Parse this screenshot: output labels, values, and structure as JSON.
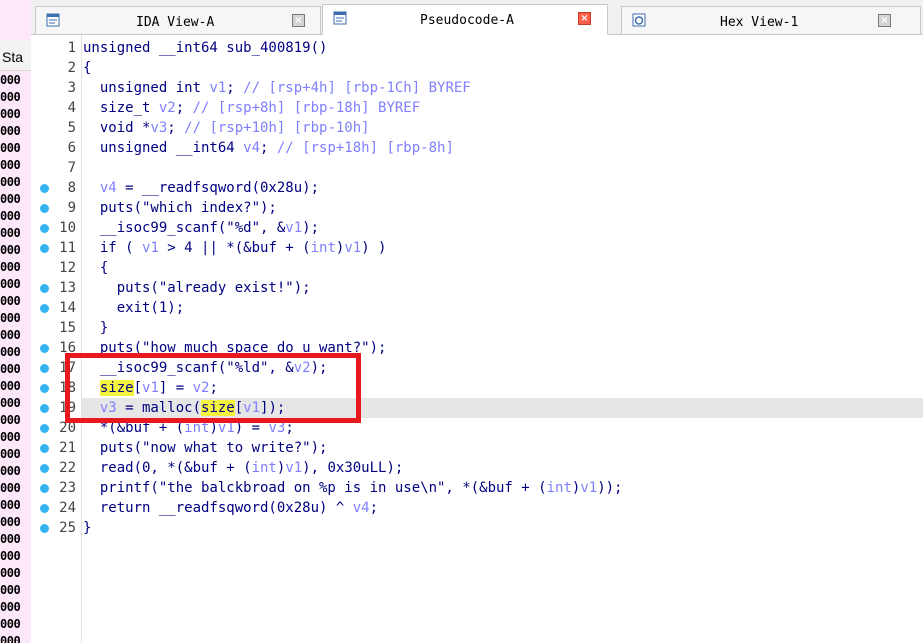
{
  "left_panel": {
    "header": "Sta",
    "cells": [
      "000",
      "000",
      "000",
      "000",
      "000",
      "000",
      "000",
      "000",
      "000",
      "000",
      "000",
      "000",
      "000",
      "000",
      "000",
      "000",
      "000",
      "000",
      "000",
      "000",
      "000",
      "000",
      "000",
      "000",
      "000",
      "000",
      "000",
      "000",
      "000",
      "000",
      "000",
      "000",
      "000",
      "000",
      "000"
    ]
  },
  "tabs": [
    {
      "label": "IDA View-A",
      "icon": "ida-view-icon",
      "active": false
    },
    {
      "label": "Pseudocode-A",
      "icon": "pseudocode-icon",
      "active": true
    },
    {
      "label": "Hex View-1",
      "icon": "hex-view-icon",
      "active": false
    }
  ],
  "code": [
    {
      "n": "1",
      "bp": false,
      "text": "unsigned __int64 sub_400819()",
      "comment": ""
    },
    {
      "n": "2",
      "bp": false,
      "text": "{",
      "comment": ""
    },
    {
      "n": "3",
      "bp": false,
      "text": "  unsigned int v1; ",
      "comment": "// [rsp+4h] [rbp-1Ch] BYREF"
    },
    {
      "n": "4",
      "bp": false,
      "text": "  size_t v2; ",
      "comment": "// [rsp+8h] [rbp-18h] BYREF"
    },
    {
      "n": "5",
      "bp": false,
      "text": "  void *v3; ",
      "comment": "// [rsp+10h] [rbp-10h]"
    },
    {
      "n": "6",
      "bp": false,
      "text": "  unsigned __int64 v4; ",
      "comment": "// [rsp+18h] [rbp-8h]"
    },
    {
      "n": "7",
      "bp": false,
      "text": "",
      "comment": ""
    },
    {
      "n": "8",
      "bp": true,
      "text": "  v4 = __readfsqword(0x28u);",
      "comment": ""
    },
    {
      "n": "9",
      "bp": true,
      "text": "  puts(\"which index?\");",
      "comment": ""
    },
    {
      "n": "10",
      "bp": true,
      "text": "  __isoc99_scanf(\"%d\", &v1);",
      "comment": ""
    },
    {
      "n": "11",
      "bp": true,
      "text": "  if ( v1 > 4 || *(&buf + (int)v1) )",
      "comment": ""
    },
    {
      "n": "12",
      "bp": false,
      "text": "  {",
      "comment": ""
    },
    {
      "n": "13",
      "bp": true,
      "text": "    puts(\"already exist!\");",
      "comment": ""
    },
    {
      "n": "14",
      "bp": true,
      "text": "    exit(1);",
      "comment": ""
    },
    {
      "n": "15",
      "bp": false,
      "text": "  }",
      "comment": ""
    },
    {
      "n": "16",
      "bp": true,
      "text": "  puts(\"how much space do u want?\");",
      "comment": ""
    },
    {
      "n": "17",
      "bp": true,
      "text": "  __isoc99_scanf(\"%ld\", &v2);",
      "comment": ""
    },
    {
      "n": "18",
      "bp": true,
      "text": "  size[v1] = v2;",
      "comment": ""
    },
    {
      "n": "19",
      "bp": true,
      "text": "  v3 = malloc(size[v1]);",
      "comment": ""
    },
    {
      "n": "20",
      "bp": true,
      "text": "  *(&buf + (int)v1) = v3;",
      "comment": ""
    },
    {
      "n": "21",
      "bp": true,
      "text": "  puts(\"now what to write?\");",
      "comment": ""
    },
    {
      "n": "22",
      "bp": true,
      "text": "  read(0, *(&buf + (int)v1), 0x30uLL);",
      "comment": ""
    },
    {
      "n": "23",
      "bp": true,
      "text": "  printf(\"the balckbroad on %p is in use\\n\", *(&buf + (int)v1));",
      "comment": ""
    },
    {
      "n": "24",
      "bp": true,
      "text": "  return __readfsqword(0x28u) ^ v4;",
      "comment": ""
    },
    {
      "n": "25",
      "bp": true,
      "text": "}",
      "comment": ""
    }
  ],
  "highlighted_line": "19",
  "highlighted_word": "size",
  "colors": {
    "code": "#000080",
    "comment": "#7f7fff",
    "breakpoint": "#33b3f0",
    "word_highlight": "#f4f440",
    "annotation_box": "#e8181f"
  }
}
